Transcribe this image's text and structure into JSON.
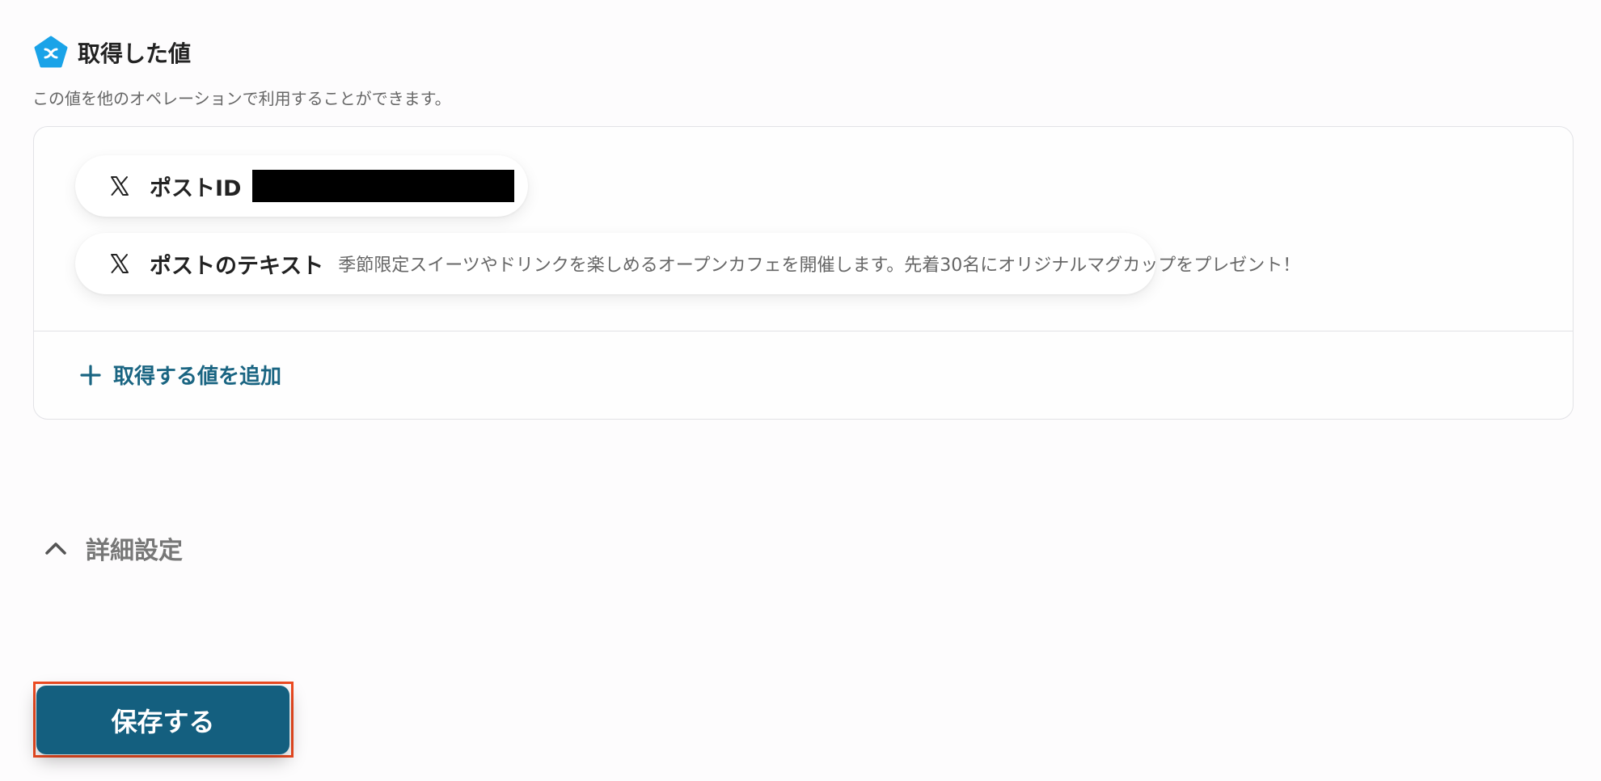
{
  "section": {
    "icon": "yoom-pentagon-icon",
    "title": "取得した値",
    "description": "この値を他のオペレーションで利用することができます。"
  },
  "values": [
    {
      "icon": "x-logo-icon",
      "label": "ポストID",
      "value": "",
      "redacted": true
    },
    {
      "icon": "x-logo-icon",
      "label": "ポストのテキスト",
      "value": "季節限定スイーツやドリンクを楽しめるオープンカフェを開催します。先着30名にオリジナルマグカップをプレゼント！"
    }
  ],
  "add_value": {
    "icon": "plus-icon",
    "label": "取得する値を追加"
  },
  "advanced": {
    "icon": "chevron-up-icon",
    "label": "詳細設定"
  },
  "save": {
    "label": "保存する"
  },
  "colors": {
    "accent": "#145f7f",
    "link": "#1a6582",
    "highlight": "#ee4b22",
    "brand_icon": "#1aa3e8"
  }
}
